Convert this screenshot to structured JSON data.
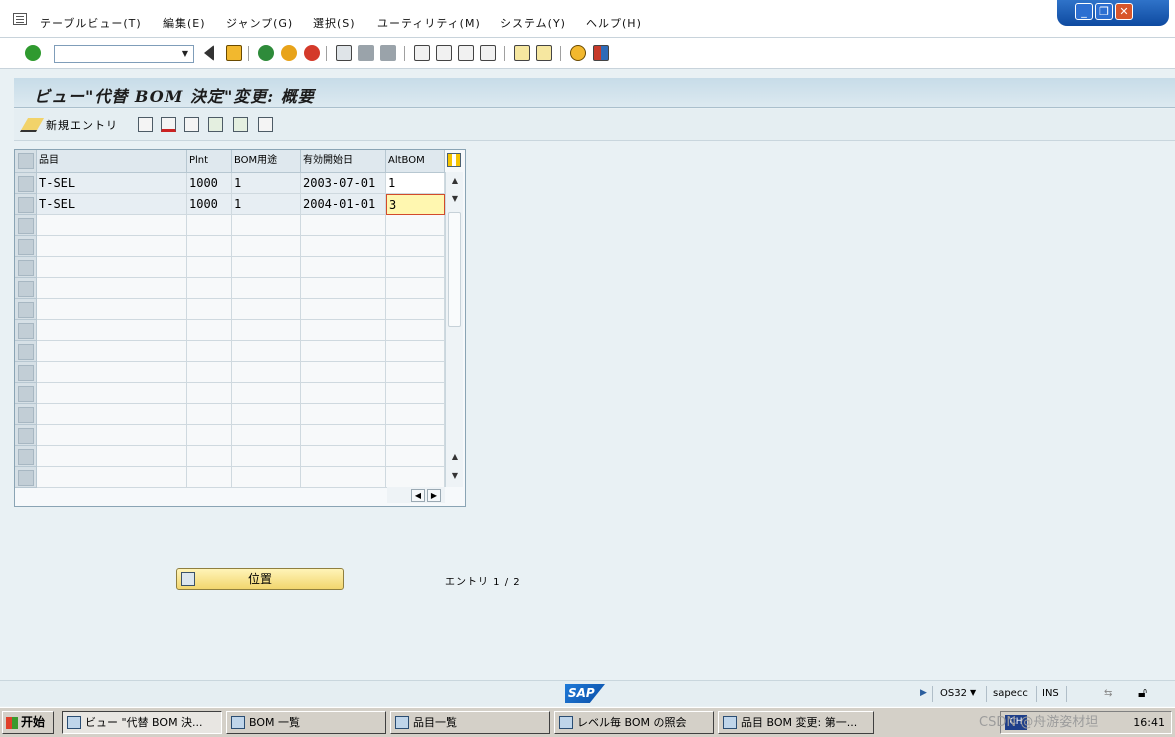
{
  "menubar": {
    "items": [
      "テーブルビュー(T)",
      "編集(E)",
      "ジャンプ(G)",
      "選択(S)",
      "ユーティリティ(M)",
      "システム(Y)",
      "ヘルプ(H)"
    ]
  },
  "window_controls": {
    "minimize": "_",
    "restore": "❐",
    "close": "✕"
  },
  "standard_toolbar": {
    "command_field_value": "",
    "icons": [
      "enter-icon",
      "back-icon",
      "save-icon",
      "back-nav-icon",
      "exit-icon",
      "cancel-icon",
      "print-icon",
      "find-icon",
      "find-next-icon",
      "first-page-icon",
      "prev-page-icon",
      "next-page-icon",
      "last-page-icon",
      "create-session-icon",
      "shortcut-icon",
      "help-icon",
      "layout-menu-icon"
    ]
  },
  "title": "ビュー\"代替 BOM 決定\"変更: 概要",
  "app_toolbar": {
    "new_entries_label": "新規エントリ"
  },
  "table": {
    "columns": [
      "品目",
      "Plnt",
      "BOM用途",
      "有効開始日",
      "AltBOM"
    ],
    "rows": [
      [
        "T-SEL",
        "1000",
        "1",
        "2003-07-01",
        "1"
      ],
      [
        "T-SEL",
        "1000",
        "1",
        "2004-01-01",
        "3"
      ]
    ],
    "empty_row_count": 13
  },
  "position_button_label": "位置",
  "entry_count": "エントリ 1 / 2",
  "statusbar": {
    "sap_logo": "SAP",
    "transaction": "OS32",
    "server": "sapecc",
    "mode": "INS"
  },
  "taskbar": {
    "start_label": "开始",
    "tasks": [
      "ビュー \"代替 BOM 決...",
      "BOM 一覧",
      "品目一覧",
      "レベル毎 BOM の照会",
      "品目 BOM 変更: 第一..."
    ],
    "tray_lang": "CH",
    "watermark": "CSDN @舟游姿材坦",
    "clock": "16:41"
  }
}
